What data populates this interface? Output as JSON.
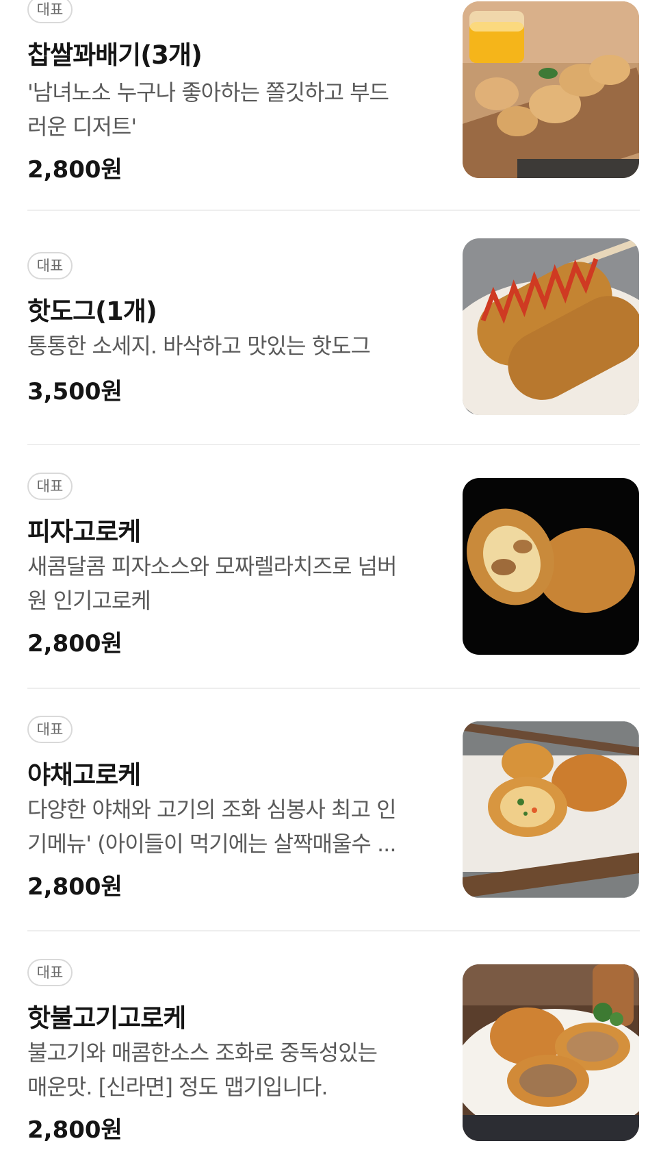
{
  "menu": {
    "items": [
      {
        "badge": "대표",
        "name": "찹쌀꽈배기(3개)",
        "desc_line1": "'남녀노소 누구나 좋아하는 쫄깃하고 부드",
        "desc_line2": "러운 디저트'",
        "price": "2,800원",
        "photo_subject": "twisted-donuts"
      },
      {
        "badge": "대표",
        "name": "핫도그(1개)",
        "desc_line1": "통통한 소세지. 바삭하고 맛있는 핫도그",
        "desc_line2": "",
        "price": "3,500원",
        "photo_subject": "corn-dogs"
      },
      {
        "badge": "대표",
        "name": "피자고로케",
        "desc_line1": "새콤달콤 피자소스와 모짜렐라치즈로 넘버",
        "desc_line2": "원 인기고로케",
        "price": "2,800원",
        "photo_subject": "pizza-croquettes"
      },
      {
        "badge": "대표",
        "name": "야채고로케",
        "desc_line1": "다양한 야채와 고기의 조화 심봉사 최고 인",
        "desc_line2": "기메뉴' (아이들이 먹기에는 살짝매울수 ...",
        "price": "2,800원",
        "photo_subject": "vegetable-croquettes"
      },
      {
        "badge": "대표",
        "name": "핫불고기고로케",
        "desc_line1": "불고기와 매콤한소스 조화로 중독성있는",
        "desc_line2": "매운맛. [신라면] 정도 맵기입니다.",
        "price": "2,800원",
        "photo_subject": "bulgogi-croquettes"
      }
    ]
  },
  "colors": {
    "text_primary": "#151515",
    "text_secondary": "#5a5a5a",
    "badge_border": "#d9d9d9",
    "divider": "#eeeeee"
  }
}
